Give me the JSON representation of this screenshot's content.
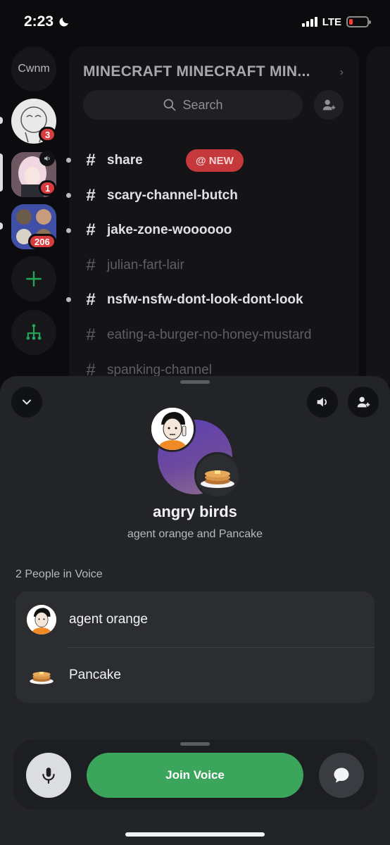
{
  "status_bar": {
    "time": "2:23",
    "network": "LTE"
  },
  "server_rail": {
    "text_server": "Cwnm",
    "servers": [
      {
        "badge": "3"
      },
      {
        "badge": "1"
      },
      {
        "badge": "206"
      }
    ]
  },
  "channel_panel": {
    "server_name": "MINECRAFT MINECRAFT MIN...",
    "search_placeholder": "Search",
    "new_badge": "@ NEW",
    "channels": [
      {
        "name": "share",
        "state": "unread"
      },
      {
        "name": "scary-channel-butch",
        "state": "unread"
      },
      {
        "name": "jake-zone-woooooo",
        "state": "unread"
      },
      {
        "name": "julian-fart-lair",
        "state": "muted"
      },
      {
        "name": "nsfw-nsfw-dont-look-dont-look",
        "state": "unread"
      },
      {
        "name": "eating-a-burger-no-honey-mustard",
        "state": "muted"
      },
      {
        "name": "spanking-channel",
        "state": "muted"
      }
    ]
  },
  "voice_sheet": {
    "group_name": "angry birds",
    "members_line": "agent orange and Pancake",
    "people_count": "2 People in Voice",
    "people": [
      {
        "name": "agent orange"
      },
      {
        "name": "Pancake"
      }
    ],
    "join_label": "Join Voice"
  },
  "colors": {
    "join_green": "#3ba55c",
    "badge_red": "#d83c3e",
    "sheet_bg": "#232428",
    "app_bg": "#0c0c0e"
  },
  "icons": [
    "moon-icon",
    "signal-icon",
    "battery-icon",
    "search-icon",
    "add-member-icon",
    "hash-icon",
    "speaker-icon",
    "chevron-down-icon",
    "plus-icon",
    "discover-icon",
    "microphone-icon",
    "chat-bubble-icon"
  ]
}
